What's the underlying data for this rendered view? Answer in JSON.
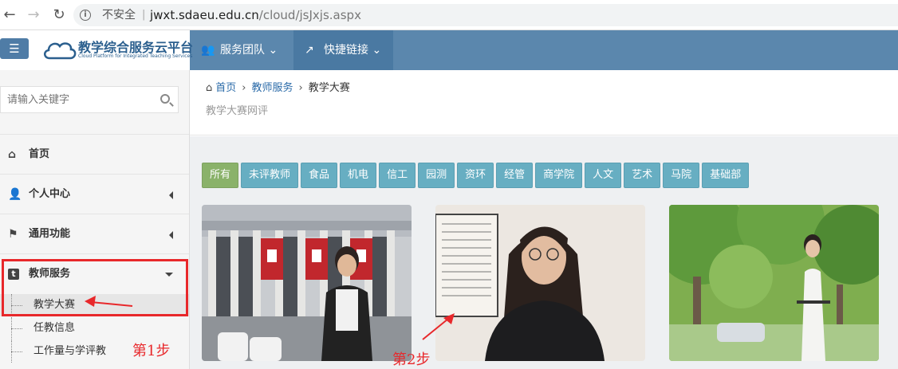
{
  "browser": {
    "security_label": "不安全",
    "url_host": "jwxt.sdaeu.edu.cn",
    "url_path": "/cloud/jsJxjs.aspx"
  },
  "brand": {
    "title": "教学综合服务云平台",
    "subtitle": "Cloud Platform for Integrated Teaching Services"
  },
  "topmenu": [
    {
      "label": "服务团队",
      "icon": "users-icon"
    },
    {
      "label": "快捷链接",
      "icon": "external-link-icon"
    }
  ],
  "sidebar": {
    "search_placeholder": "请输入关键字",
    "items": [
      {
        "label": "首页",
        "icon": "home-icon"
      },
      {
        "label": "个人中心",
        "icon": "user-icon"
      },
      {
        "label": "通用功能",
        "icon": "flag-icon"
      },
      {
        "label": "教师服务",
        "icon": "tumblr-icon"
      }
    ],
    "sub_items": [
      "教学大赛",
      "任教信息",
      "工作量与学评教"
    ]
  },
  "annotations": {
    "step1": "第1步",
    "step2": "第2步",
    "color": "#e8282b"
  },
  "breadcrumb": {
    "home": "首页",
    "section": "教师服务",
    "current": "教学大赛"
  },
  "page_subtitle": "教学大赛网评",
  "filters": [
    "所有",
    "未评教师",
    "食品",
    "机电",
    "信工",
    "园测",
    "资环",
    "经管",
    "商学院",
    "人文",
    "艺术",
    "马院",
    "基础部"
  ],
  "colors": {
    "header": "#5b87ad",
    "filter_active": "#8ab26a",
    "filter": "#67aec2",
    "link": "#2a6aa8"
  }
}
